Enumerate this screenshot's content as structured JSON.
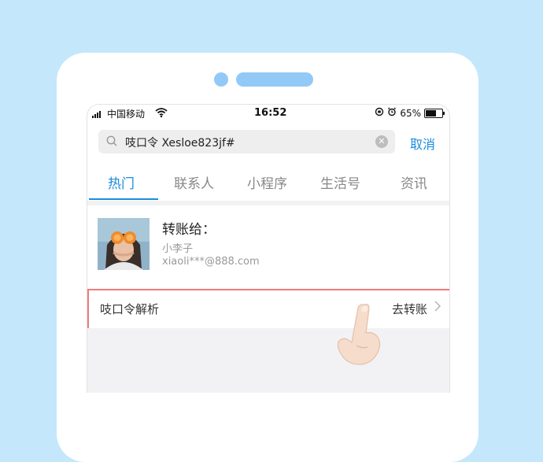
{
  "status_bar": {
    "carrier": "中国移动",
    "time": "16:52",
    "battery_percent": "65%",
    "battery_level": 0.65
  },
  "search": {
    "query": "吱口令 Xesloe823jf#",
    "cancel_label": "取消"
  },
  "tabs": [
    {
      "label": "热门",
      "active": true
    },
    {
      "label": "联系人"
    },
    {
      "label": "小程序"
    },
    {
      "label": "生活号"
    },
    {
      "label": "资讯"
    }
  ],
  "result": {
    "title": "转账给：",
    "nickname": "小李子",
    "email": "xiaoli***@888.com"
  },
  "code_row": {
    "label": "吱口令解析",
    "action": "去转账"
  },
  "colors": {
    "background": "#c4e7fb",
    "accent": "#1a8cdc",
    "highlight_border": "#f07a7a"
  },
  "icons": [
    "signal-icon",
    "wifi-icon",
    "lock-rotation-icon",
    "alarm-icon",
    "battery-icon",
    "search-icon",
    "clear-icon",
    "chevron-right-icon",
    "hand-pointer-icon"
  ]
}
